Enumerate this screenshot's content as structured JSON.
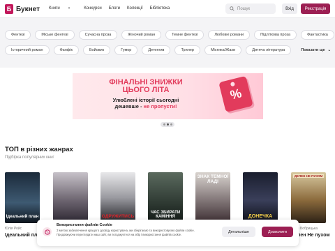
{
  "header": {
    "logo_mark": "Б",
    "logo_text": "Букнет",
    "nav": [
      "Книги",
      "Конкурси",
      "Блоги",
      "Колекції",
      "Бібліотека"
    ],
    "search_placeholder": "Пошук",
    "login_label": "Вхід",
    "register_label": "Реєстрація"
  },
  "genres": {
    "row1": [
      "Фентезі",
      "Міське фентезі",
      "Сучасна проза",
      "Жіночий роман",
      "Темне фентезі",
      "Любовні романи",
      "Підліткова проза",
      "Фантастика"
    ],
    "row2": [
      "Історичний роман",
      "Фанфік",
      "Бойовик",
      "Гумор",
      "Детектив",
      "Трилер",
      "Містика/Жахи",
      "Дитяча література"
    ],
    "more_label": "Показати ще"
  },
  "banner": {
    "title_line1": "ФІНАЛЬНІ ЗНИЖКИ",
    "title_line2": "ЦЬОГО ЛІТА",
    "sub_line1": "Улюблені історії сьогодні",
    "sub_line2_prefix": "дешевше - ",
    "sub_line2_highlight": "не пропусти!",
    "tag_symbol": "%"
  },
  "top": {
    "title": "ТОП в різних жанрах",
    "subtitle": "Підбірка популярних книг",
    "books": [
      {
        "cover": "Ідеальний план",
        "author": "Юлія Ройс",
        "title": "Ідеальний план"
      },
      {
        "cover": "",
        "author": "",
        "title": ""
      },
      {
        "cover": "ОДРУЖИТИСЬ",
        "author": "",
        "title": ""
      },
      {
        "cover": "ЧАС ЗБИРАТИ КАМІННЯ",
        "author": "",
        "title": ""
      },
      {
        "cover": "ЗНАК ТЕМНОЇ ЛАДІ",
        "author": "",
        "title": ""
      },
      {
        "cover": "ДОНЕЧКА",
        "author": "",
        "title": ""
      },
      {
        "cover": "ДЕЛЕН НЕ ПУХОМ",
        "author": "Юлія Бобрицька",
        "title": "Делен Не пухом"
      }
    ]
  },
  "cookie": {
    "title": "Використання файлів Cookie",
    "text": "З метою забезпечення кращого досвіду користувача, ми зберігаємо та використовуємо файли cookie. Продовжуючи переглядати наш сайт, ви погоджуєтеся на збір і використання файлів cookie.",
    "details_label": "Детальніше",
    "accept_label": "Дозволити"
  }
}
